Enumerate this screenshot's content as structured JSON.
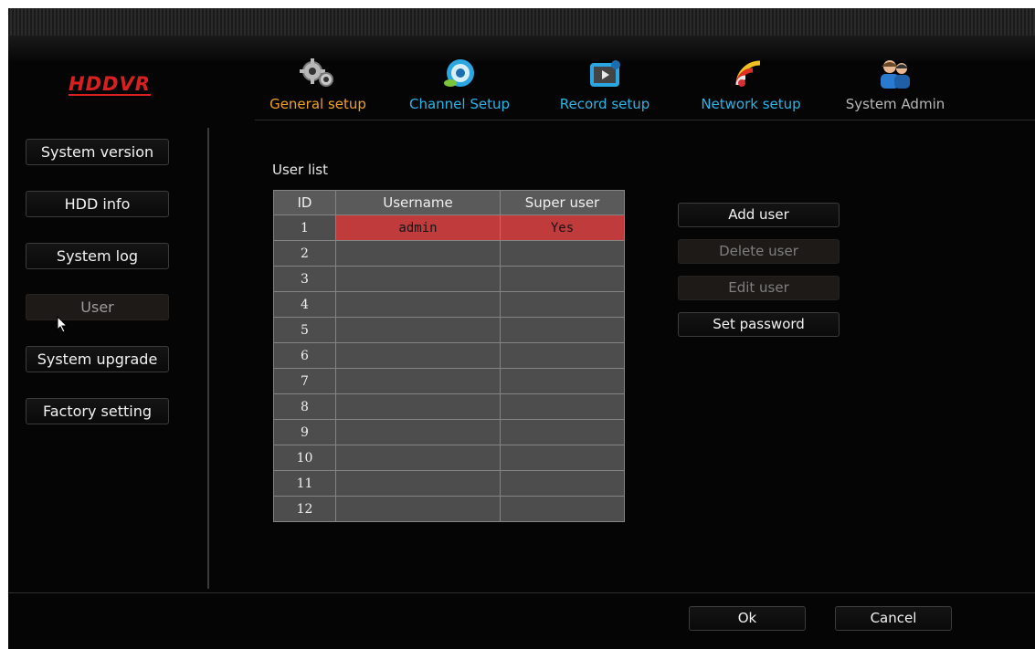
{
  "app": {
    "logo": "HDDVR"
  },
  "nav": [
    {
      "label": "General setup",
      "icon": "gears-icon",
      "color": "#f0a020"
    },
    {
      "label": "Channel Setup",
      "icon": "camera-icon",
      "color": "#27b6e8"
    },
    {
      "label": "Record setup",
      "icon": "film-icon",
      "color": "#27b6e8"
    },
    {
      "label": "Network setup",
      "icon": "wifi-signal-icon",
      "color": "#27b6e8"
    },
    {
      "label": "System Admin",
      "icon": "users-icon",
      "color": "#b8b8b8"
    }
  ],
  "sidebar": {
    "items": [
      {
        "label": "System version"
      },
      {
        "label": "HDD info"
      },
      {
        "label": "System log"
      },
      {
        "label": "User",
        "active": true
      },
      {
        "label": "System upgrade"
      },
      {
        "label": "Factory setting"
      }
    ]
  },
  "user_list": {
    "title": "User list",
    "columns": [
      "ID",
      "Username",
      "Super user"
    ],
    "rows": [
      {
        "id": "1",
        "username": "admin",
        "super_user": "Yes",
        "selected": true
      },
      {
        "id": "2",
        "username": "",
        "super_user": ""
      },
      {
        "id": "3",
        "username": "",
        "super_user": ""
      },
      {
        "id": "4",
        "username": "",
        "super_user": ""
      },
      {
        "id": "5",
        "username": "",
        "super_user": ""
      },
      {
        "id": "6",
        "username": "",
        "super_user": ""
      },
      {
        "id": "7",
        "username": "",
        "super_user": ""
      },
      {
        "id": "8",
        "username": "",
        "super_user": ""
      },
      {
        "id": "9",
        "username": "",
        "super_user": ""
      },
      {
        "id": "10",
        "username": "",
        "super_user": ""
      },
      {
        "id": "11",
        "username": "",
        "super_user": ""
      },
      {
        "id": "12",
        "username": "",
        "super_user": ""
      }
    ]
  },
  "actions": {
    "add_user": "Add user",
    "delete_user": "Delete user",
    "edit_user": "Edit user",
    "set_password": "Set password"
  },
  "footer": {
    "ok": "Ok",
    "cancel": "Cancel"
  },
  "colors": {
    "selected_row": "#c03b3b",
    "logo": "#d82020",
    "active_tab": "#f0a020",
    "tab": "#27b6e8"
  }
}
